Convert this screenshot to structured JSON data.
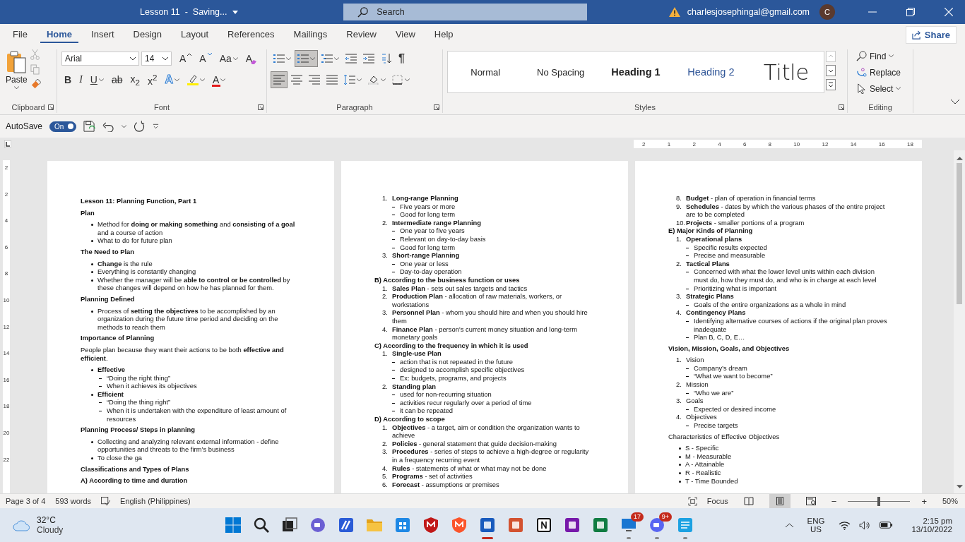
{
  "title_bar": {
    "doc_title": "Lesson 11  -  Saving...",
    "search_placeholder": "Search",
    "account": "charlesjosephingal@gmail.com",
    "avatar": "C"
  },
  "menu_tabs": [
    {
      "label": "File",
      "selected": false
    },
    {
      "label": "Home",
      "selected": true
    },
    {
      "label": "Insert",
      "selected": false
    },
    {
      "label": "Design",
      "selected": false
    },
    {
      "label": "Layout",
      "selected": false
    },
    {
      "label": "References",
      "selected": false
    },
    {
      "label": "Mailings",
      "selected": false
    },
    {
      "label": "Review",
      "selected": false
    },
    {
      "label": "View",
      "selected": false
    },
    {
      "label": "Help",
      "selected": false
    }
  ],
  "share": "Share",
  "ribbon": {
    "paste": "Paste",
    "font_family": "Arial",
    "font_size": "14",
    "font_row1": [
      {
        "kind": "grow",
        "glyph": "A"
      },
      {
        "kind": "shrink",
        "glyph": "A"
      },
      {
        "kind": "case",
        "glyph": "Aa"
      },
      {
        "kind": "clear",
        "glyph": "A"
      }
    ],
    "font_row2": [
      {
        "kind": "bold",
        "glyph": "B"
      },
      {
        "kind": "italic",
        "glyph": "I"
      },
      {
        "kind": "underline",
        "glyph": "U"
      },
      {
        "kind": "strike",
        "glyph": "ab"
      },
      {
        "kind": "sub",
        "glyph": "x$_{2}$"
      },
      {
        "kind": "sup",
        "glyph": "x$^{2}$"
      },
      {
        "kind": "effects",
        "glyph": "A"
      },
      {
        "kind": "highlight"
      },
      {
        "kind": "color",
        "glyph": "A"
      }
    ],
    "para_row1": [
      {
        "kind": "bullets",
        "selected": false
      },
      {
        "kind": "numbering",
        "selected": true
      },
      {
        "kind": "multilevel",
        "selected": false
      },
      {
        "kind": "outdent",
        "selected": false
      },
      {
        "kind": "indent",
        "selected": false
      },
      {
        "kind": "sort",
        "selected": false
      },
      {
        "kind": "pilcrow",
        "glyph": "¶",
        "selected": false
      }
    ],
    "para_row2": [
      {
        "kind": "left",
        "selected": true
      },
      {
        "kind": "center",
        "selected": false
      },
      {
        "kind": "right",
        "selected": false
      },
      {
        "kind": "justify",
        "selected": false
      },
      {
        "kind": "spacing",
        "selected": false
      },
      {
        "kind": "shading",
        "selected": false
      },
      {
        "kind": "borders",
        "selected": false
      }
    ],
    "styles": [
      {
        "kind": "normal",
        "label": "Normal"
      },
      {
        "kind": "nospacing",
        "label": "No Spacing"
      },
      {
        "kind": "heading1",
        "label": "Heading 1"
      },
      {
        "kind": "heading2",
        "label": "Heading 2"
      },
      {
        "kind": "title",
        "label": "Title"
      }
    ],
    "editing": [
      {
        "kind": "find",
        "label": "Find"
      },
      {
        "kind": "replace",
        "label": "Replace"
      },
      {
        "kind": "select",
        "label": "Select"
      }
    ],
    "groups": [
      "Clipboard",
      "Font",
      "Paragraph",
      "Styles",
      "Editing"
    ]
  },
  "qat": {
    "autosave": "AutoSave",
    "autosave_on": true,
    "on_label": "On"
  },
  "ruler": [
    "2",
    "1",
    "2",
    "4",
    "6",
    "8",
    "10",
    "12",
    "14",
    "16",
    "18"
  ],
  "vertical_ruler": [
    "2",
    "2",
    "4",
    "6",
    "8",
    "10",
    "12",
    "14",
    "16",
    "18",
    "20",
    "22"
  ],
  "pages": [
    {
      "blocks": [
        {
          "kind": "heading",
          "bold": true,
          "text": "Lesson 11: Planning Function, Part 1"
        },
        {
          "kind": "heading",
          "bold": true,
          "text": "Plan"
        },
        {
          "kind": "bullet",
          "text": "Method for **doing or making something** and **consisting of a goal** and a course of action"
        },
        {
          "kind": "bullet",
          "text": "What to do for future plan"
        },
        {
          "kind": "heading",
          "bold": true,
          "text": "The Need to Plan"
        },
        {
          "kind": "bullet",
          "text": "**Change** is the rule"
        },
        {
          "kind": "bullet",
          "text": "Everything is constantly changing"
        },
        {
          "kind": "bullet",
          "text": "Whether the manager will be **able to control or be controlled** by these changes will depend on how he has planned for them."
        },
        {
          "kind": "heading",
          "bold": true,
          "text": "Planning Defined"
        },
        {
          "kind": "bullet",
          "text": "Process of **setting the objectives** to be accomplished by an organization during the future time period and deciding on the methods to reach them"
        },
        {
          "kind": "heading",
          "bold": true,
          "text": "Importance of Planning"
        },
        {
          "kind": "para",
          "text": "People plan because they want their actions to be both **effective and efficient**."
        },
        {
          "kind": "bullet",
          "text": "**Effective**",
          "children": [
            "“Doing the right thing”",
            "When it achieves its objectives"
          ]
        },
        {
          "kind": "bullet",
          "text": "**Efficient**",
          "children": [
            "“Doing the thing right”",
            "When it is undertaken with the expenditure of least amount of resources"
          ]
        },
        {
          "kind": "heading",
          "bold": true,
          "text": "Planning Process/ Steps in planning"
        },
        {
          "kind": "bullet",
          "text": "Collecting and analyzing relevant external information - define opportunities and threats to the firm’s business"
        },
        {
          "kind": "bullet",
          "text": "To close the ga"
        },
        {
          "kind": "heading",
          "bold": true,
          "text": "Classifications and Types of Plans"
        },
        {
          "kind": "heading",
          "bold": true,
          "text": "A) According to time and duration"
        }
      ]
    },
    {
      "blocks": [
        {
          "kind": "num",
          "marker": "1.",
          "text": "**Long-range Planning**",
          "children": [
            "Five years or more",
            "Good for long term"
          ]
        },
        {
          "kind": "num",
          "marker": "2.",
          "text": "**Intermediate range Planning**",
          "children": [
            "One year to five years",
            "Relevant on day-to-day basis",
            "Good for long term"
          ]
        },
        {
          "kind": "num",
          "marker": "3.",
          "text": "**Short-range Planning**",
          "children": [
            "One year or less",
            "Day-to-day operation"
          ]
        },
        {
          "kind": "section",
          "text": "B) According to the business function or uses"
        },
        {
          "kind": "num",
          "marker": "1.",
          "text": "**Sales Plan** - sets out sales targets and tactics"
        },
        {
          "kind": "num",
          "marker": "2.",
          "text": "**Production Plan** - allocation of raw materials, workers, or workstations"
        },
        {
          "kind": "num",
          "marker": "3.",
          "text": "**Personnel Plan** - whom you should hire and when you should hire them"
        },
        {
          "kind": "num",
          "marker": "4.",
          "text": "**Finance Plan** - person’s current money situation and long-term monetary goals"
        },
        {
          "kind": "section",
          "text": "C) According to the frequency in which it is used"
        },
        {
          "kind": "num",
          "marker": "1.",
          "text": "**Single-use Plan**",
          "children": [
            "action that is not repeated in the future",
            "designed to accomplish specific objectives",
            "Ex: budgets, programs, and projects"
          ]
        },
        {
          "kind": "num",
          "marker": "2.",
          "text": "**Standing plan**",
          "children": [
            "used for non-recurring situation",
            "activities recur regularly over a period of time",
            "it can be repeated"
          ]
        },
        {
          "kind": "section",
          "text": "D) According to scope"
        },
        {
          "kind": "num",
          "marker": "1.",
          "text": "**Objectives** - a target, aim or condition the organization wants to achieve"
        },
        {
          "kind": "num",
          "marker": "2.",
          "text": "**Policies** - general statement that guide decision-making"
        },
        {
          "kind": "num",
          "marker": "3.",
          "text": "**Procedures** - series of steps to achieve a high-degree or regularity in a frequency recurring event"
        },
        {
          "kind": "num",
          "marker": "4.",
          "text": "**Rules** - statements of what or what may not be done"
        },
        {
          "kind": "num",
          "marker": "5.",
          "text": "**Programs** - set of activities"
        },
        {
          "kind": "num",
          "marker": "6.",
          "text": "**Forecast** - assumptions or premises"
        }
      ]
    },
    {
      "blocks": [
        {
          "kind": "num",
          "marker": "8.",
          "text": "**Budget** - plan of operation in financial terms"
        },
        {
          "kind": "num",
          "marker": "9.",
          "text": "**Schedules** - dates by which the various phases of the entire project are to be completed"
        },
        {
          "kind": "num",
          "marker": "10.",
          "text": "**Projects** - smaller portions of a program"
        },
        {
          "kind": "section",
          "text": "E) Major Kinds of Planning"
        },
        {
          "kind": "num",
          "marker": "1.",
          "text": "**Operational plans**",
          "children": [
            "Specific results expected",
            "Precise and measurable"
          ]
        },
        {
          "kind": "num",
          "marker": "2.",
          "text": "**Tactical Plans**",
          "children": [
            "Concerned with what the lower level units within each division must do, how they must do, and who is in charge at each level",
            "Prioritizing what is important"
          ]
        },
        {
          "kind": "num",
          "marker": "3.",
          "text": "**Strategic Plans**",
          "children": [
            "Goals of the entire organizations as a whole in mind"
          ]
        },
        {
          "kind": "num",
          "marker": "4.",
          "text": "**Contingency Plans**",
          "children": [
            "Identifying alternative courses of actions if the original plan proves inadequate",
            "Plan B, C, D, E…"
          ]
        },
        {
          "kind": "heading",
          "bold": true,
          "text": "Vision, Mission, Goals, and Objectives"
        },
        {
          "kind": "num",
          "marker": "1.",
          "text": "Vision",
          "children": [
            "Company’s dream",
            "“What we want to become”"
          ]
        },
        {
          "kind": "num",
          "marker": "2.",
          "text": "Mission",
          "children": [
            "“Who we are”"
          ]
        },
        {
          "kind": "num",
          "marker": "3.",
          "text": "Goals",
          "children": [
            "Expected or desired income"
          ]
        },
        {
          "kind": "num",
          "marker": "4.",
          "text": "Objectives",
          "children": [
            "Precise targets"
          ]
        },
        {
          "kind": "heading",
          "bold": false,
          "text": "Characteristics of Effective Objectives"
        },
        {
          "kind": "bullet",
          "text": "S - Specific"
        },
        {
          "kind": "bullet",
          "text": "M - Measurable"
        },
        {
          "kind": "bullet",
          "text": "A - Attainable"
        },
        {
          "kind": "bullet",
          "text": "R - Realistic"
        },
        {
          "kind": "bullet",
          "text": "T - Time Bounded"
        }
      ]
    }
  ],
  "status_bar": {
    "page": "Page 3 of 4",
    "words": "593 words",
    "language": "English (Philippines)",
    "focus": "Focus",
    "views": [
      {
        "kind": "read",
        "selected": false
      },
      {
        "kind": "print",
        "selected": true
      },
      {
        "kind": "web",
        "selected": false
      }
    ],
    "zoom_minus": "−",
    "zoom_plus": "+",
    "zoom_slider": {
      "level": 0.5
    },
    "zoom": "50%"
  },
  "taskbar": {
    "temperature": "32°C",
    "weather": "Cloudy",
    "apps": [
      {
        "kind": "windows",
        "running": false,
        "active": false
      },
      {
        "kind": "search",
        "running": false,
        "active": false
      },
      {
        "kind": "taskview",
        "running": false,
        "active": false
      },
      {
        "kind": "meet",
        "running": false,
        "active": false
      },
      {
        "kind": "stripes",
        "running": false,
        "active": false
      },
      {
        "kind": "folder",
        "running": false,
        "active": false
      },
      {
        "kind": "store",
        "running": false,
        "active": false
      },
      {
        "kind": "shield",
        "running": false,
        "active": false
      },
      {
        "kind": "lion",
        "running": false,
        "active": false
      },
      {
        "kind": "word",
        "running": true,
        "active": true
      },
      {
        "kind": "slides",
        "running": false,
        "active": false
      },
      {
        "kind": "cube",
        "running": false,
        "active": false
      },
      {
        "kind": "notebook",
        "running": false,
        "active": false
      },
      {
        "kind": "sheet",
        "running": false,
        "active": false
      },
      {
        "kind": "monitor",
        "running": true,
        "active": false,
        "badge": "17"
      },
      {
        "kind": "chat",
        "running": true,
        "active": false,
        "badge": "9+"
      },
      {
        "kind": "notepad",
        "running": true,
        "active": false
      }
    ],
    "lang1": "ENG",
    "lang2": "US",
    "time": "2:15 pm",
    "date": "13/10/2022"
  }
}
